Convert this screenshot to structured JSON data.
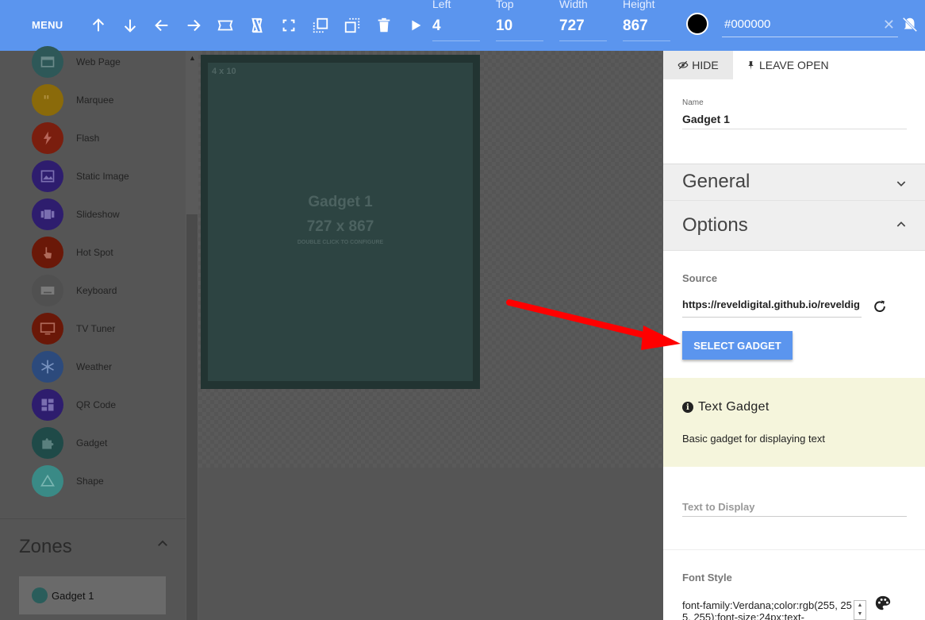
{
  "toolbar": {
    "menu_label": "MENU",
    "fields": [
      {
        "label": "Left",
        "value": "4"
      },
      {
        "label": "Top",
        "value": "10"
      },
      {
        "label": "Width",
        "value": "727"
      },
      {
        "label": "Height",
        "value": "867"
      }
    ],
    "color_hex": "#000000",
    "color_swatch": "#000000",
    "accent": "#5b95ee"
  },
  "widgets": [
    {
      "label": "Web Page",
      "icon": "web-page-icon",
      "color": "#2e5858"
    },
    {
      "label": "Marquee",
      "icon": "quote-icon",
      "color": "#8a6a0a"
    },
    {
      "label": "Flash",
      "icon": "flash-icon",
      "color": "#7a1e0e"
    },
    {
      "label": "Static Image",
      "icon": "image-icon",
      "color": "#2e1d6e"
    },
    {
      "label": "Slideshow",
      "icon": "slideshow-icon",
      "color": "#2e1d6e"
    },
    {
      "label": "Hot Spot",
      "icon": "touch-icon",
      "color": "#6a1808"
    },
    {
      "label": "Keyboard",
      "icon": "keyboard-icon",
      "color": "#505050"
    },
    {
      "label": "TV Tuner",
      "icon": "tv-icon",
      "color": "#6a1808"
    },
    {
      "label": "Weather",
      "icon": "snowflake-icon",
      "color": "#2c4a7c"
    },
    {
      "label": "QR Code",
      "icon": "qr-code-icon",
      "color": "#2e1d6e"
    },
    {
      "label": "Gadget",
      "icon": "puzzle-icon",
      "color": "#1f4a48"
    },
    {
      "label": "Shape",
      "icon": "triangle-icon",
      "color": "#3a8a86"
    }
  ],
  "zones": {
    "title": "Zones",
    "items": [
      {
        "label": "Gadget 1"
      }
    ]
  },
  "canvas": {
    "zone_coords": "4 x 10",
    "zone_name": "Gadget 1",
    "zone_size": "727 x 867",
    "zone_hint": "DOUBLE CLICK TO CONFIGURE"
  },
  "panel": {
    "hide_label": "HIDE",
    "leave_open_label": "LEAVE OPEN",
    "name_label": "Name",
    "name_value": "Gadget 1",
    "general_title": "General",
    "options_title": "Options",
    "source_label": "Source",
    "source_value": "https://reveldigital.github.io/reveldig",
    "select_gadget_label": "SELECT GADGET",
    "info_title": "Text Gadget",
    "info_desc": "Basic gadget for displaying text",
    "text_label": "Text to Display",
    "font_label": "Font Style",
    "font_value": "font-family:Verdana;color:rgb(255, 255, 255);font-size:24px;text-"
  }
}
